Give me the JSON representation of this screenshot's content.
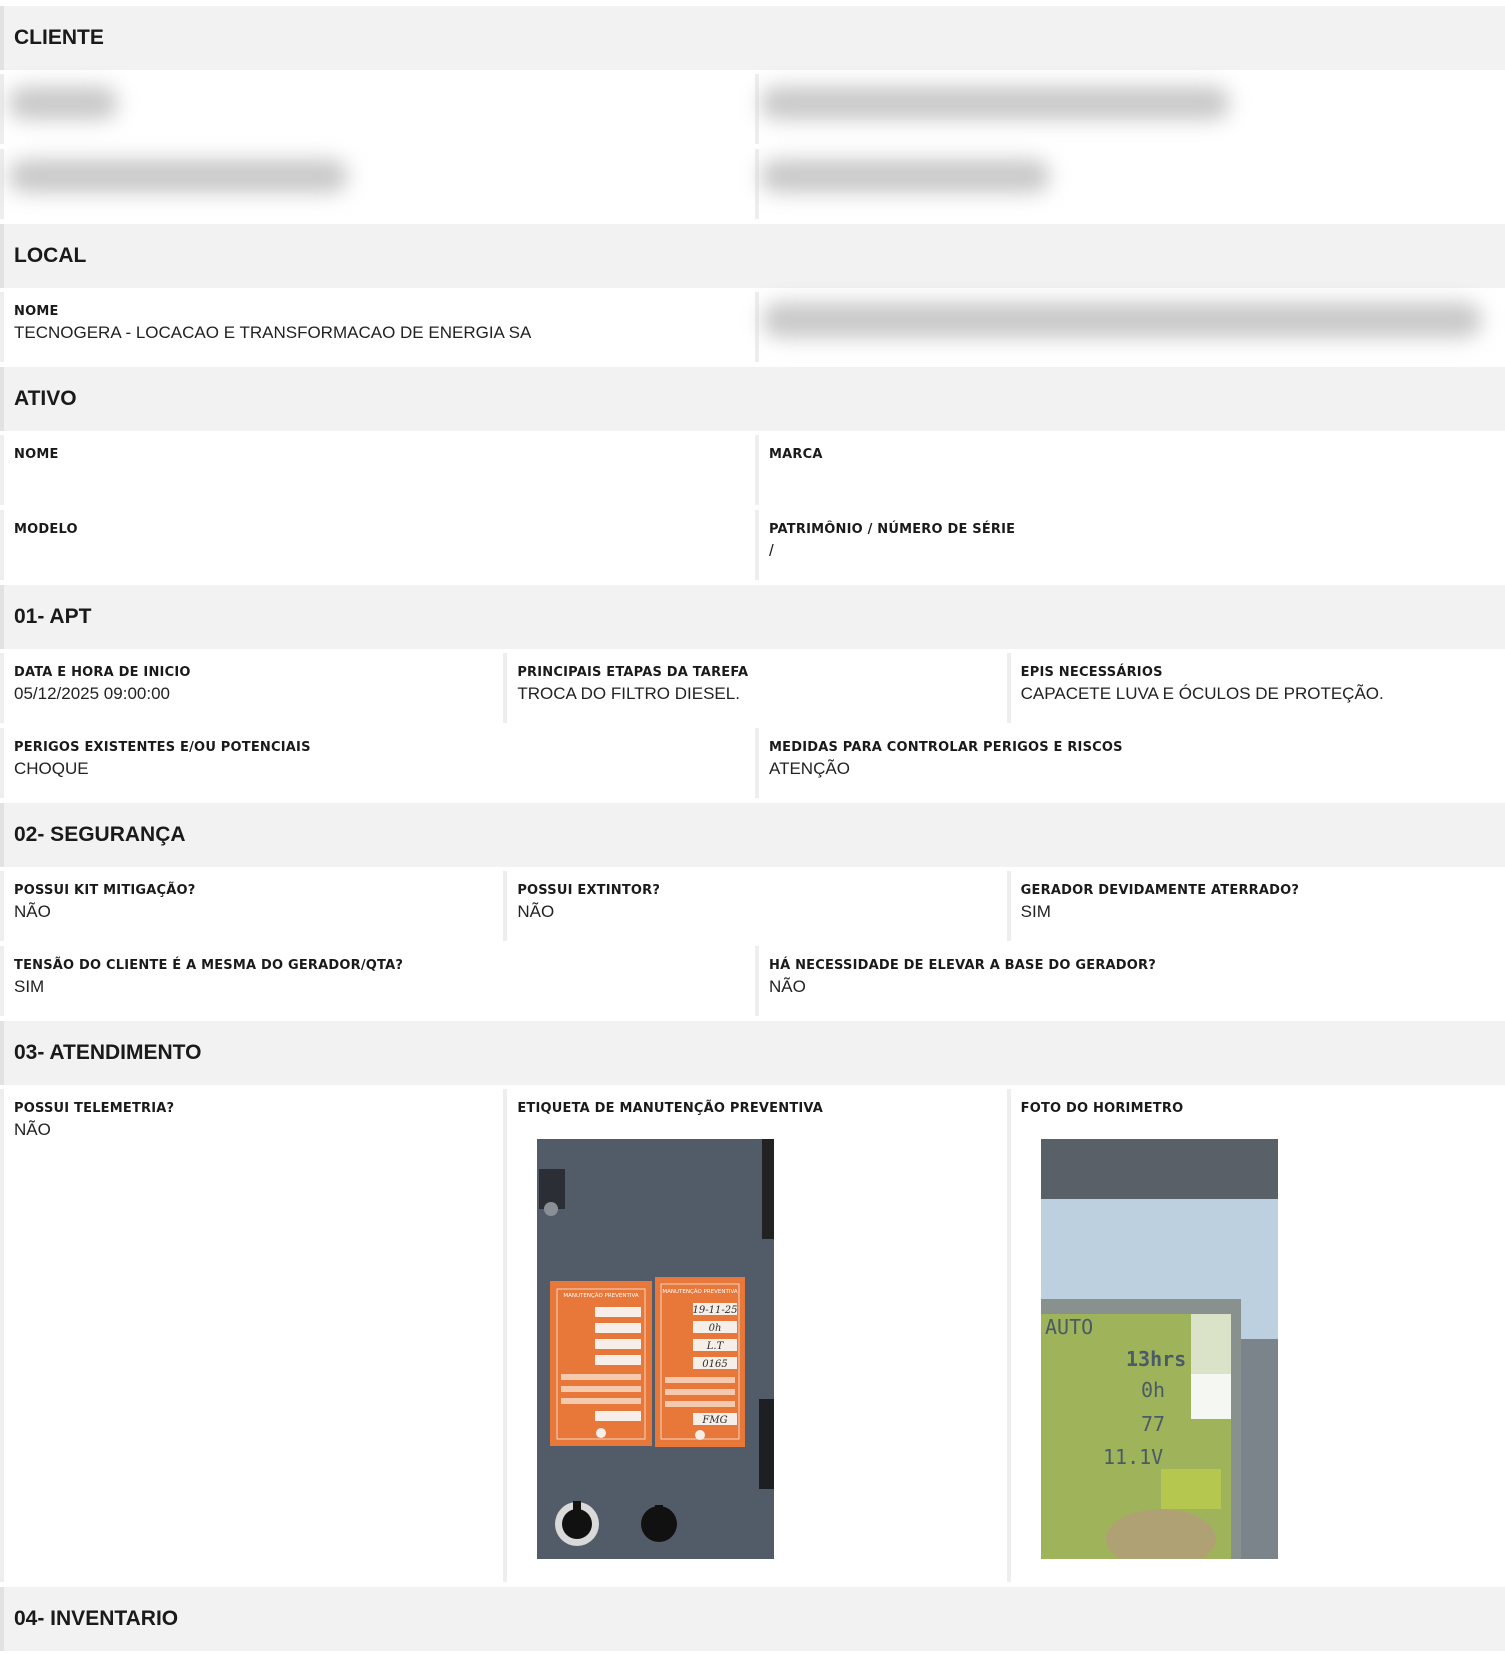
{
  "sections": {
    "cliente": "CLIENTE",
    "local": "LOCAL",
    "ativo": "ATIVO",
    "apt": "01- APT",
    "seguranca": "02- SEGURANÇA",
    "atendimento": "03- ATENDIMENTO",
    "inventario": "04- INVENTARIO"
  },
  "local": {
    "nome_label": "NOME",
    "nome_value": "TECNOGERA - LOCACAO E TRANSFORMACAO DE ENERGIA SA"
  },
  "ativo": {
    "nome_label": "NOME",
    "nome_value": "",
    "marca_label": "MARCA",
    "marca_value": "",
    "modelo_label": "MODELO",
    "modelo_value": "",
    "patrimonio_label": "PATRIMÔNIO / NÚMERO DE SÉRIE",
    "patrimonio_value": "/"
  },
  "apt": {
    "data_label": "DATA E HORA DE INICIO",
    "data_value": "05/12/2025 09:00:00",
    "etapas_label": "PRINCIPAIS ETAPAS DA TAREFA",
    "etapas_value": "TROCA DO FILTRO DIESEL.",
    "epis_label": "EPIS NECESSÁRIOS",
    "epis_value": "CAPACETE LUVA E ÓCULOS DE PROTEÇÃO.",
    "perigos_label": "PERIGOS EXISTENTES E/OU POTENCIAIS",
    "perigos_value": "CHOQUE",
    "medidas_label": "MEDIDAS PARA CONTROLAR PERIGOS E RISCOS",
    "medidas_value": "ATENÇÃO"
  },
  "seguranca": {
    "kit_label": "POSSUI KIT MITIGAÇÃO?",
    "kit_value": "NÃO",
    "extintor_label": "POSSUI EXTINTOR?",
    "extintor_value": "NÃO",
    "aterrado_label": "GERADOR DEVIDAMENTE ATERRADO?",
    "aterrado_value": "SIM",
    "tensao_label": "TENSÃO DO CLIENTE É A MESMA DO GERADOR/QTA?",
    "tensao_value": "SIM",
    "base_label": "HÁ NECESSIDADE DE ELEVAR A BASE DO GERADOR?",
    "base_value": "NÃO"
  },
  "atendimento": {
    "telemetria_label": "POSSUI TELEMETRIA?",
    "telemetria_value": "NÃO",
    "etiqueta_label": "ETIQUETA DE MANUTENÇÃO PREVENTIVA",
    "horimetro_label": "FOTO DO HORIMETRO"
  },
  "photos": {
    "label_left_title": "MANUTENÇÃO PREVENTIVA",
    "label_right_title": "MANUTENÇÃO PREVENTIVA",
    "label_right_date": "19-11-25",
    "label_right_hours": "0h",
    "label_right_plano": "L.T",
    "label_right_horimetro": "0165",
    "label_right_resp": "FMG",
    "display_mode": "AUTO",
    "display_hours": "13hrs",
    "display_min": "0h",
    "display_temp": "77",
    "display_volt": "11.1V"
  }
}
